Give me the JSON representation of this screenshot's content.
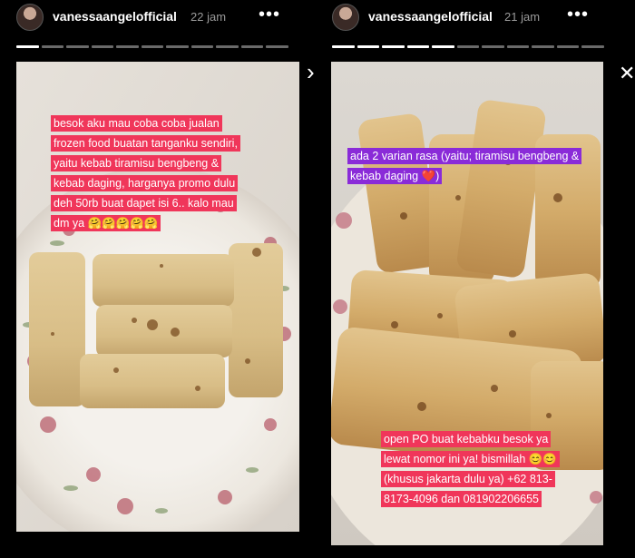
{
  "stories": [
    {
      "username": "vanessaangelofficial",
      "time": "22 jam",
      "more": "•••",
      "progress_total": 11,
      "progress_done": 1,
      "caption_color": "#f0365a",
      "caption": "besok aku mau coba coba jualan frozen food buatan tanganku sendiri, yaitu kebab tiramisu bengbeng & kebab daging, harganya promo dulu deh 50rb buat dapet isi 6.. kalo mau dm ya 🤗🤗🤗🤗🤗"
    },
    {
      "username": "vanessaangelofficial",
      "time": "21 jam",
      "more": "•••",
      "progress_total": 11,
      "progress_done": 5,
      "caption_top_color": "#8a2bd8",
      "caption_top": "ada 2 varian rasa (yaitu; tiramisu bengbeng & kebab daging ❤️)",
      "caption_bottom_color": "#f0365a",
      "caption_bottom": "open PO buat kebabku besok ya lewat nomor ini ya! bismillah 😊😊 (khusus jakarta dulu ya) +62 813-8173-4096 dan 081902206655"
    }
  ],
  "nav": {
    "next_icon": "›",
    "close_icon": "✕"
  }
}
